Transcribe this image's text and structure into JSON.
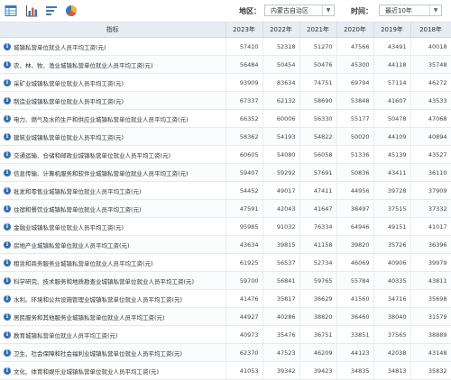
{
  "toolbar": {
    "icons": [
      "table-view-icon",
      "bar-chart-icon",
      "list-view-icon",
      "pie-chart-icon"
    ],
    "region_label": "地区：",
    "region_value": "内蒙古自治区",
    "time_label": "时间：",
    "time_value": "最近10年",
    "dropdown_arrow": "▼"
  },
  "table": {
    "headers": [
      "指标",
      "2023年",
      "2022年",
      "2021年",
      "2020年",
      "2019年",
      "2018年"
    ],
    "info_glyph": "i",
    "rows": [
      {
        "name": "城镇私营单位就业人员平均工资(元)",
        "values": [
          "57410",
          "52318",
          "51270",
          "47566",
          "43491",
          "40018"
        ]
      },
      {
        "name": "农、林、牧、渔业城镇私营单位就业人员平均工资(元)",
        "values": [
          "56484",
          "50454",
          "50476",
          "45300",
          "44118",
          "35748"
        ]
      },
      {
        "name": "采矿业城镇私营单位就业人员平均工资(元)",
        "values": [
          "93909",
          "83634",
          "74751",
          "69794",
          "57114",
          "46272"
        ]
      },
      {
        "name": "制造业城镇私营单位就业人员平均工资(元)",
        "values": [
          "67337",
          "62132",
          "58690",
          "53848",
          "41607",
          "43533"
        ]
      },
      {
        "name": "电力、燃气及水的生产和供应业城镇私营单位就业人员平均工资(元)",
        "values": [
          "66352",
          "60006",
          "56330",
          "55177",
          "50478",
          "47068"
        ]
      },
      {
        "name": "建筑业城镇私营单位就业人员平均工资(元)",
        "values": [
          "58362",
          "54193",
          "54822",
          "50020",
          "44109",
          "40894"
        ]
      },
      {
        "name": "交通运输、仓储和邮政业城镇私营单位就业人员平均工资(元)",
        "values": [
          "60605",
          "54080",
          "56058",
          "51336",
          "45139",
          "43527"
        ]
      },
      {
        "name": "信息传输、计算机服务和软件业城镇私营单位就业人员平均工资(元)",
        "values": [
          "59407",
          "59292",
          "57691",
          "50836",
          "43411",
          "36110"
        ]
      },
      {
        "name": "批发和零售业城镇私营单位就业人员平均工资(元)",
        "values": [
          "54452",
          "49017",
          "47411",
          "44956",
          "39728",
          "37909"
        ]
      },
      {
        "name": "住宿和餐饮业城镇私营单位就业人员平均工资(元)",
        "values": [
          "47591",
          "42043",
          "41647",
          "38497",
          "37515",
          "37332"
        ]
      },
      {
        "name": "金融业城镇私营单位就业人员平均工资(元)",
        "values": [
          "95985",
          "91032",
          "76334",
          "64946",
          "49151",
          "41017"
        ]
      },
      {
        "name": "房地产业城镇私营单位就业人员平均工资(元)",
        "values": [
          "43634",
          "39815",
          "41158",
          "39820",
          "35726",
          "36396"
        ]
      },
      {
        "name": "租赁和商务服务业城镇私营单位就业人员平均工资(元)",
        "values": [
          "61925",
          "56537",
          "52734",
          "46069",
          "40906",
          "39979"
        ]
      },
      {
        "name": "科学研究、技术服务和地质勘查业城镇私营单位就业人员平均工资(元)",
        "values": [
          "59700",
          "56841",
          "59765",
          "55784",
          "40335",
          "43811"
        ]
      },
      {
        "name": "水利、环境和公共设施管理业城镇私营单位就业人员平均工资(元)",
        "values": [
          "41476",
          "35817",
          "36629",
          "41560",
          "34716",
          "35698"
        ]
      },
      {
        "name": "居民服务和其他服务业城镇私营单位就业人员平均工资(元)",
        "values": [
          "44927",
          "40286",
          "38820",
          "36460",
          "38040",
          "31579"
        ]
      },
      {
        "name": "教育城镇私营单位就业人员平均工资(元)",
        "values": [
          "40973",
          "35476",
          "36751",
          "33851",
          "37565",
          "38889"
        ]
      },
      {
        "name": "卫生、社会保障和社会福利业城镇私营单位就业人员平均工资(元)",
        "values": [
          "62370",
          "47523",
          "46209",
          "44123",
          "42038",
          "43148"
        ]
      },
      {
        "name": "文化、体育和娱乐业城镇私营单位就业人员平均工资(元)",
        "values": [
          "41053",
          "39342",
          "39423",
          "34835",
          "34813",
          "35832"
        ]
      }
    ]
  }
}
